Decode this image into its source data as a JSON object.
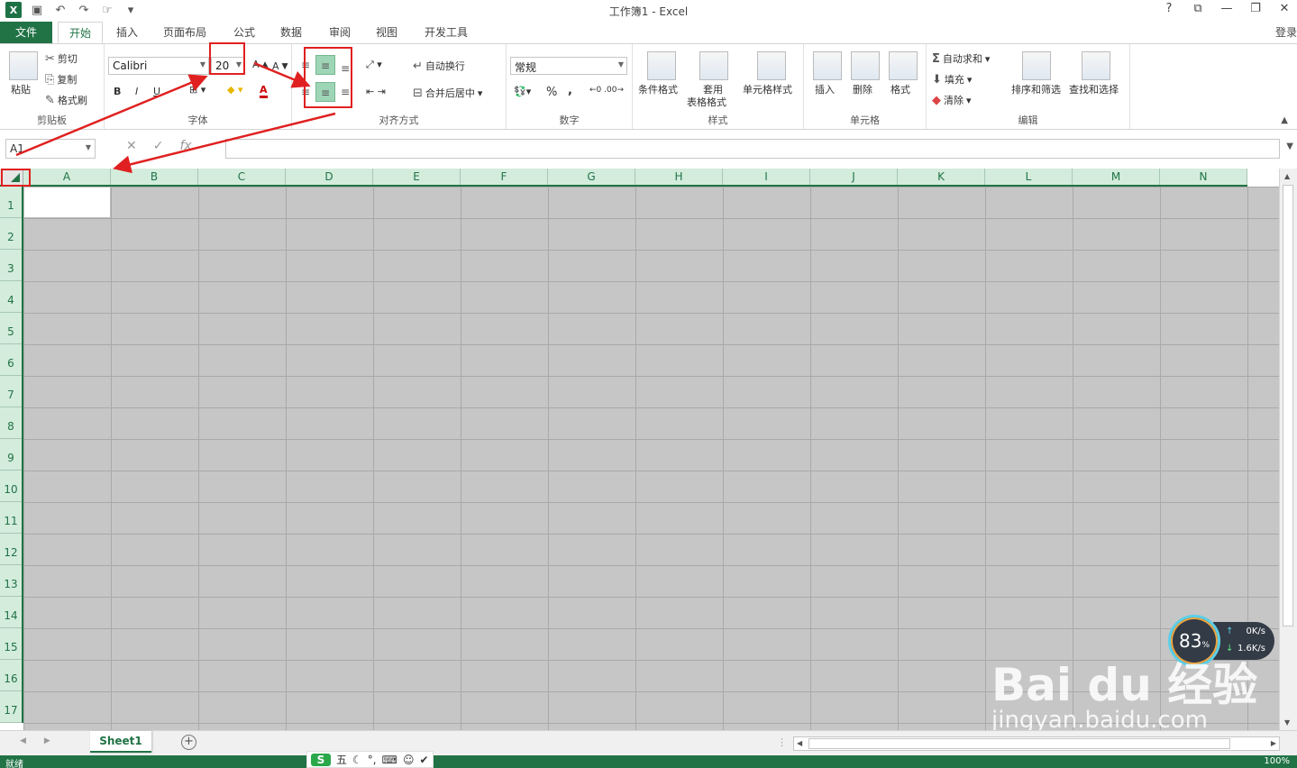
{
  "window": {
    "title": "工作簿1 - Excel",
    "help": "?",
    "login": "登录"
  },
  "tabs": [
    "开始",
    "插入",
    "页面布局",
    "公式",
    "数据",
    "审阅",
    "视图",
    "开发工具"
  ],
  "file_tab": "文件",
  "ribbon": {
    "clipboard": {
      "paste": "粘贴",
      "cut": "剪切",
      "copy": "复制",
      "format_painter": "格式刷",
      "label": "剪贴板"
    },
    "font": {
      "name": "Calibri",
      "size": "20",
      "bold": "B",
      "italic": "I",
      "underline": "U",
      "font_color": "A",
      "label": "字体"
    },
    "alignment": {
      "wrap": "自动换行",
      "merge": "合并后居中",
      "label": "对齐方式"
    },
    "number": {
      "format": "常规",
      "percent": "%",
      "comma": ",",
      "label": "数字"
    },
    "styles": {
      "conditional": "条件格式",
      "table1": "套用",
      "table2": "表格格式",
      "cell_styles": "单元格样式",
      "label": "样式"
    },
    "cells": {
      "insert": "插入",
      "delete": "删除",
      "format": "格式",
      "label": "单元格"
    },
    "editing": {
      "autosum": "自动求和",
      "fill": "填充",
      "clear": "清除",
      "sort": "排序和筛选",
      "find": "查找和选择",
      "label": "编辑"
    }
  },
  "formula_bar": {
    "name_box": "A1",
    "fx": "fx",
    "value": ""
  },
  "columns": [
    "A",
    "B",
    "C",
    "D",
    "E",
    "F",
    "G",
    "H",
    "I",
    "J",
    "K",
    "L",
    "M",
    "N"
  ],
  "rows": [
    "1",
    "2",
    "3",
    "4",
    "5",
    "6",
    "7",
    "8",
    "9",
    "10",
    "11",
    "12",
    "13",
    "14",
    "15",
    "16",
    "17"
  ],
  "sheet": {
    "name": "Sheet1",
    "add": "+"
  },
  "status": {
    "ready": "就绪",
    "zoom": "100%"
  },
  "ime": {
    "s": "S",
    "wu": "五"
  },
  "speed": {
    "value": "83",
    "unit": "%",
    "up": "0K/s",
    "down": "1.6K/s"
  },
  "watermark": {
    "main": "Bai du 经验",
    "sub": "jingyan.baidu.com"
  }
}
